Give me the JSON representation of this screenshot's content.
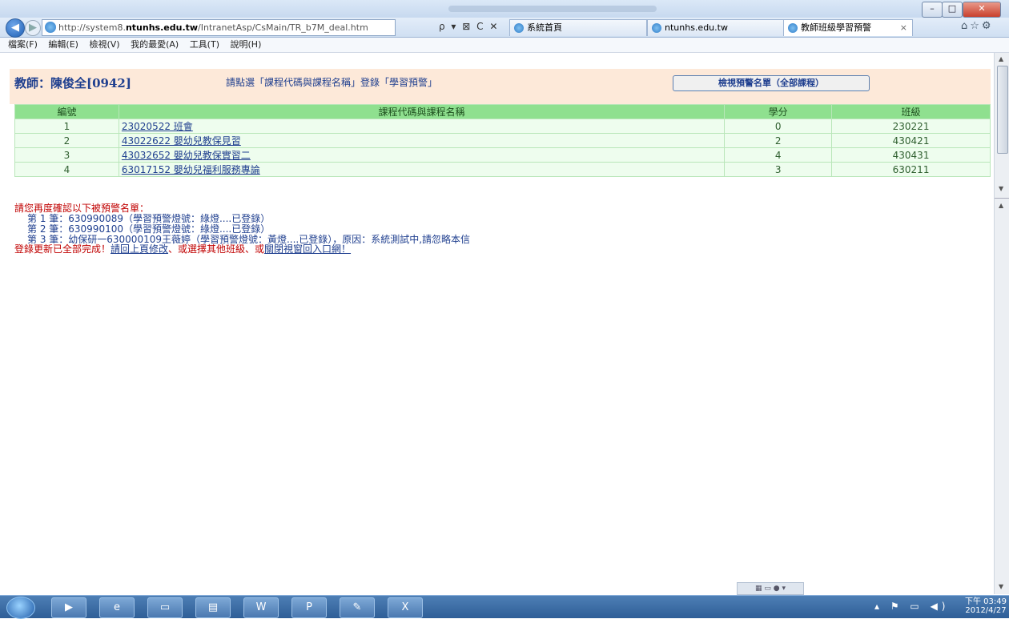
{
  "browser": {
    "url_prefix": "http://system8.",
    "url_domain": "ntunhs.edu.tw",
    "url_path": "/IntranetAsp/CsMain/TR_b7M_deal.htm",
    "address_tools": "ρ ▾ ⊠ C ✕",
    "tabs": [
      {
        "label": "系統首頁"
      },
      {
        "label": "ntunhs.edu.tw"
      },
      {
        "label": "教師班級學習預警"
      }
    ],
    "menu": [
      "檔案(F)",
      "編輯(E)",
      "檢視(V)",
      "我的最愛(A)",
      "工具(T)",
      "說明(H)"
    ]
  },
  "page": {
    "teacher_label": "教師：陳俊全[0942]",
    "instruction": "請點選「課程代碼與課程名稱」登錄「學習預警」",
    "view_button": "檢視預警名單（全部課程）",
    "table": {
      "headers": [
        "編號",
        "課程代碼與課程名稱",
        "學分",
        "班級"
      ],
      "rows": [
        {
          "no": "1",
          "course": "23020522 班會",
          "credits": "0",
          "class": "230221"
        },
        {
          "no": "2",
          "course": "43022622 嬰幼兒教保見習",
          "credits": "2",
          "class": "430421"
        },
        {
          "no": "3",
          "course": "43032652 嬰幼兒教保實習二",
          "credits": "4",
          "class": "430431"
        },
        {
          "no": "4",
          "course": "63017152 嬰幼兒福利服務專論",
          "credits": "3",
          "class": "630211"
        }
      ]
    },
    "warning_heading": "請您再度確認以下被預警名單：",
    "warning_lines": [
      "第 1 筆：630990089（學習預警燈號：綠燈....已登錄）",
      "第 2 筆：630990100（學習預警燈號：綠燈....已登錄）",
      "第 3 筆：幼保研一630000109王薇婷（學習預警燈號：黃燈....已登錄），原因：系統測試中,請忽略本信"
    ],
    "done_text": "登錄更新已全部完成！",
    "back_link": "請回上頁修改",
    "middle_text": "、或選擇其他班級、或",
    "close_link": "關閉視窗回入口網！"
  },
  "taskbar": {
    "clock_period": "下午 03:49",
    "clock_date": "2012/4/27"
  }
}
